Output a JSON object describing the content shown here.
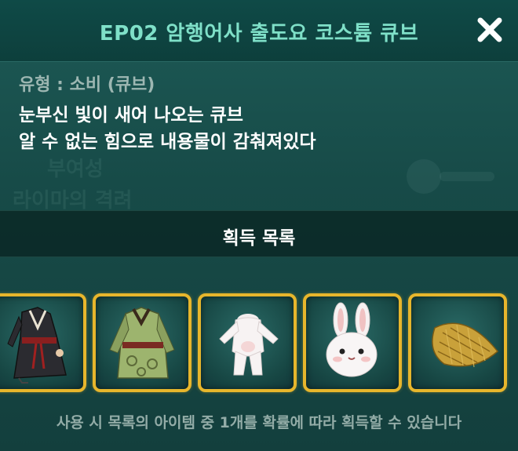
{
  "popup": {
    "title": "EP02 암행어사 출도요 코스튬 큐브",
    "close_icon": "close-icon",
    "type_label": "유형 : 소비 (큐브)",
    "description": [
      "눈부신 빛이 새어 나오는 큐브",
      "알 수 없는 힘으로 내용물이 감춰져있다"
    ],
    "list_title": "획득 목록",
    "items": [
      {
        "icon": "black-hanbok-costume-icon"
      },
      {
        "icon": "green-hanbok-robe-icon"
      },
      {
        "icon": "white-fur-bodysuit-icon"
      },
      {
        "icon": "white-rabbit-head-icon"
      },
      {
        "icon": "straw-bamboo-hat-icon"
      }
    ],
    "footer": "사용 시 목록의 아이템 중 1개를 확률에 따라 획득할 수 있습니다",
    "colors": {
      "title": "#7fe0c8",
      "slot_border": "#e7b62c",
      "background": "#174b48"
    }
  }
}
